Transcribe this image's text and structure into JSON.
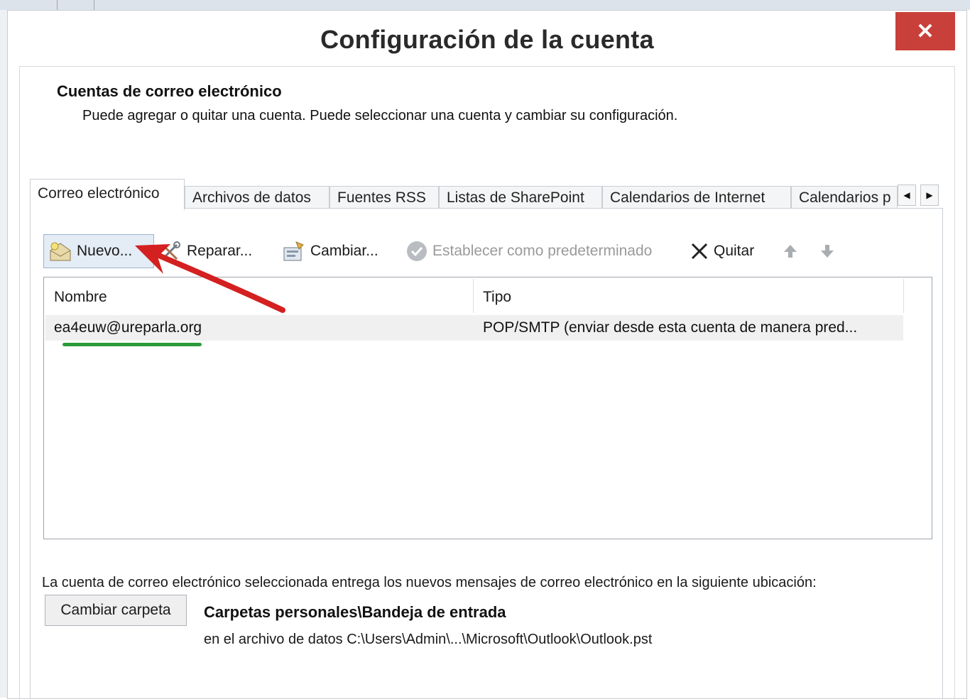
{
  "dialog": {
    "title": "Configuración de la cuenta",
    "close_symbol": "✕"
  },
  "header": {
    "section_title": "Cuentas de correo electrónico",
    "description": "Puede agregar o quitar una cuenta. Puede seleccionar una cuenta y cambiar su configuración."
  },
  "tabs": [
    {
      "label": "Correo electrónico",
      "active": true
    },
    {
      "label": "Archivos de datos"
    },
    {
      "label": "Fuentes RSS"
    },
    {
      "label": "Listas de SharePoint"
    },
    {
      "label": "Calendarios de Internet"
    },
    {
      "label": "Calendarios p"
    }
  ],
  "tab_scroll": {
    "left": "◀",
    "right": "▶"
  },
  "toolbar": {
    "new_label": "Nuevo...",
    "repair_label": "Reparar...",
    "change_label": "Cambiar...",
    "set_default_label": "Establecer como predeterminado",
    "remove_label": "Quitar"
  },
  "grid": {
    "columns": [
      "Nombre",
      "Tipo"
    ],
    "rows": [
      {
        "name": "ea4euw@ureparla.org",
        "type": "POP/SMTP (enviar desde esta cuenta de manera pred..."
      }
    ]
  },
  "footer": {
    "info": "La cuenta de correo electrónico seleccionada entrega los nuevos mensajes de correo electrónico en la siguiente ubicación:",
    "change_folder_label": "Cambiar carpeta",
    "folder_title": "Carpetas personales\\Bandeja de entrada",
    "folder_path": "en el archivo de datos C:\\Users\\Admin\\...\\Microsoft\\Outlook\\Outlook.pst"
  },
  "colors": {
    "close_button": "#c9403a",
    "annotation_arrow": "#d42020",
    "annotation_underline": "#2a9b3c"
  }
}
